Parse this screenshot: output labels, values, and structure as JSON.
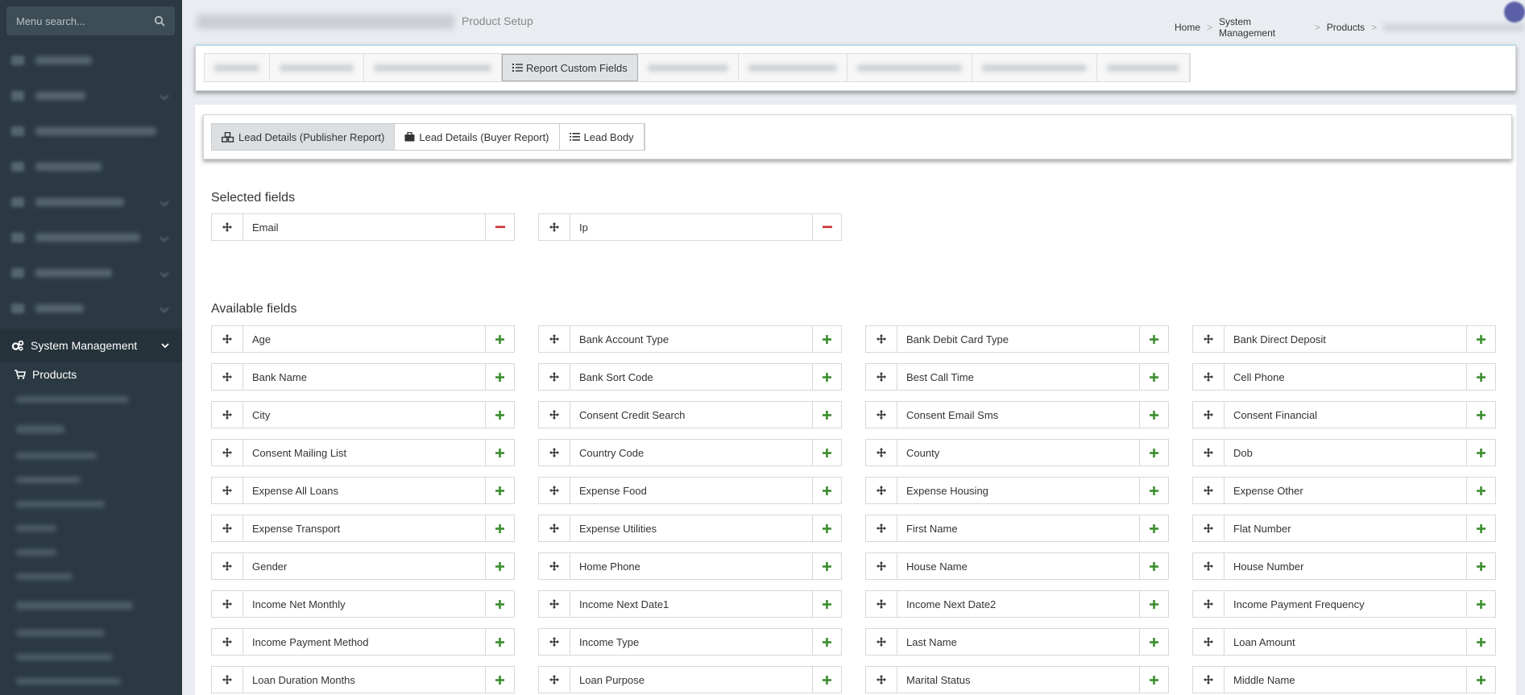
{
  "sidebar": {
    "search_placeholder": "Menu search...",
    "active_section": "System Management",
    "active_item": "Products"
  },
  "header": {
    "subtitle": "Product Setup",
    "breadcrumb": [
      "Home",
      "System Management",
      "Products"
    ]
  },
  "top_tabs": {
    "active": "Report Custom Fields"
  },
  "sub_tabs": [
    {
      "label": "Lead Details (Publisher Report)",
      "icon": "cubes-icon",
      "active": true
    },
    {
      "label": "Lead Details (Buyer Report)",
      "icon": "briefcase-icon",
      "active": false
    },
    {
      "label": "Lead Body",
      "icon": "list-icon",
      "active": false
    }
  ],
  "selected": {
    "title": "Selected fields",
    "fields": [
      "Email",
      "Ip"
    ]
  },
  "available": {
    "title": "Available fields",
    "fields": [
      "Age",
      "Bank Account Type",
      "Bank Debit Card Type",
      "Bank Direct Deposit",
      "Bank Name",
      "Bank Sort Code",
      "Best Call Time",
      "Cell Phone",
      "City",
      "Consent Credit Search",
      "Consent Email Sms",
      "Consent Financial",
      "Consent Mailing List",
      "Country Code",
      "County",
      "Dob",
      "Expense All Loans",
      "Expense Food",
      "Expense Housing",
      "Expense Other",
      "Expense Transport",
      "Expense Utilities",
      "First Name",
      "Flat Number",
      "Gender",
      "Home Phone",
      "House Name",
      "House Number",
      "Income Net Monthly",
      "Income Next Date1",
      "Income Next Date2",
      "Income Payment Frequency",
      "Income Payment Method",
      "Income Type",
      "Last Name",
      "Loan Amount",
      "Loan Duration Months",
      "Loan Purpose",
      "Marital Status",
      "Middle Name"
    ]
  },
  "colors": {
    "sidebar_bg": "#2b3a42",
    "remove": "#c9302c",
    "add": "#3c8d2f"
  }
}
